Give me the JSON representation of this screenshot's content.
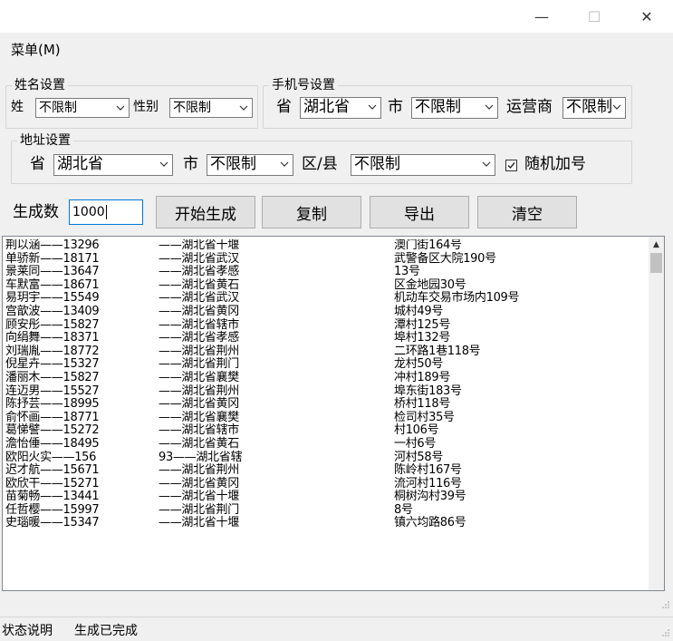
{
  "window": {
    "minimize_glyph": "—",
    "maximize_glyph": "☐",
    "close_glyph": "✕"
  },
  "menu": {
    "label": "菜单(M)"
  },
  "name_settings": {
    "legend": "姓名设置",
    "surname_label": "姓",
    "surname_value": "不限制",
    "gender_label": "性别",
    "gender_value": "不限制"
  },
  "phone_settings": {
    "legend": "手机号设置",
    "province_label": "省",
    "province_value": "湖北省",
    "city_label": "市",
    "city_value": "不限制",
    "carrier_label": "运营商",
    "carrier_value": "不限制"
  },
  "address_settings": {
    "legend": "地址设置",
    "province_label": "省",
    "province_value": "湖北省",
    "city_label": "市",
    "city_value": "不限制",
    "district_label": "区/县",
    "district_value": "不限制",
    "random_number_label": "随机加号",
    "random_number_checked": true
  },
  "actions": {
    "count_label": "生成数",
    "count_value": "1000",
    "start_label": "开始生成",
    "copy_label": "复制",
    "export_label": "导出",
    "clear_label": "清空"
  },
  "output": {
    "col_name_phone": [
      "荆以涵——13296",
      "单骄新——18171",
      "景莱同——13647",
      "车默富——18671",
      "易玥宇——15549",
      "宫歆波——13409",
      "顾安彤——15827",
      "向绢舞——18371",
      "刘瑞胤——18772",
      "倪星卉——15327",
      "潘丽木——15827",
      "连迈男——15527",
      "陈抒芸——18995",
      "俞怀画——18771",
      "葛悌譬——15272",
      "澹怡倕——18495",
      "欧阳火实——156",
      "迟才航——15671",
      "欧欣干——15271",
      "苗菊畅——13441",
      "任哲樱——15997",
      "史瑙暖——15347"
    ],
    "col_region": [
      "——湖北省十堰",
      "——湖北省武汉",
      "——湖北省孝感",
      "——湖北省黄石",
      "——湖北省武汉",
      "——湖北省黄冈",
      "——湖北省辖市",
      "——湖北省孝感",
      "——湖北省荆州",
      "——湖北省荆门",
      "——湖北省襄樊",
      "——湖北省荆州",
      "——湖北省黄冈",
      "——湖北省襄樊",
      "——湖北省辖市",
      "——湖北省黄石",
      "93——湖北省辖",
      "——湖北省荆州",
      "——湖北省黄冈",
      "——湖北省十堰",
      "——湖北省荆门",
      "——湖北省十堰"
    ],
    "col_address": [
      "澳门街164号",
      "武警备区大院190号",
      "13号",
      "区金地园30号",
      "机动车交易市场内109号",
      "城村49号",
      "潭村125号",
      "埠村132号",
      "二环路1巷118号",
      "龙村50号",
      "冲村189号",
      "埠东街183号",
      "桥村118号",
      "检司村35号",
      "村106号",
      "一村6号",
      "河村58号",
      "陈岭村167号",
      "流河村116号",
      "桐树沟村39号",
      "8号",
      "镇六均路86号"
    ]
  },
  "status": {
    "label": "状态说明",
    "value": "生成已完成"
  }
}
